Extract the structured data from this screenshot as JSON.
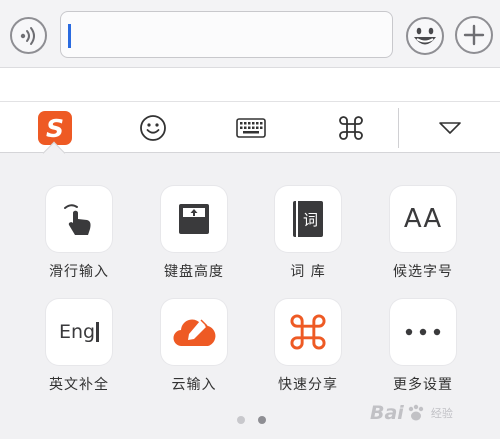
{
  "input_bar": {
    "voice_icon": "voice-waves-icon",
    "emoji_icon": "grinning-face-icon",
    "plus_icon": "plus-icon",
    "text_value": ""
  },
  "toolbar": {
    "items": [
      {
        "name": "sogou-logo",
        "glyph": "S"
      },
      {
        "name": "smiley-icon"
      },
      {
        "name": "keyboard-icon"
      },
      {
        "name": "command-key-icon"
      },
      {
        "name": "collapse-triangle-icon"
      }
    ]
  },
  "panel": {
    "items": [
      {
        "label": "滑行输入",
        "icon": "swipe-finger-icon"
      },
      {
        "label": "键盘高度",
        "icon": "keyboard-height-icon"
      },
      {
        "label": "词 库",
        "icon": "dictionary-book-icon",
        "icon_text": "词"
      },
      {
        "label": "候选字号",
        "icon": "font-size-icon",
        "icon_text": "AA"
      },
      {
        "label": "英文补全",
        "icon": "english-complete-icon",
        "icon_text": "Eng"
      },
      {
        "label": "云输入",
        "icon": "cloud-input-icon"
      },
      {
        "label": "快速分享",
        "icon": "quick-share-icon"
      },
      {
        "label": "更多设置",
        "icon": "more-dots-icon"
      }
    ]
  },
  "pagination": {
    "total": 2,
    "current": 2
  },
  "watermark": {
    "text": "Bai",
    "sub": "经验"
  },
  "colors": {
    "accent": "#ee5a24",
    "caret": "#2a6be0",
    "panel_bg": "#f1f1f3"
  }
}
